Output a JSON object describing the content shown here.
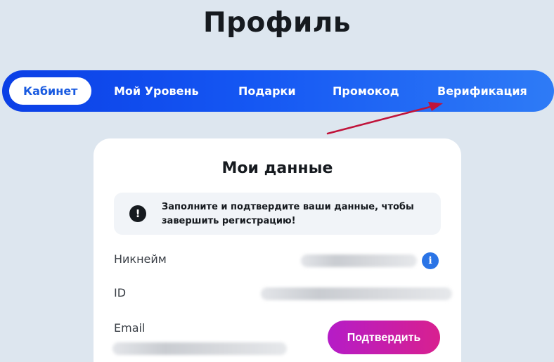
{
  "page": {
    "title": "Профиль"
  },
  "tabs": [
    {
      "label": "Кабинет",
      "active": true
    },
    {
      "label": "Мой Уровень",
      "active": false
    },
    {
      "label": "Подарки",
      "active": false
    },
    {
      "label": "Промокод",
      "active": false
    },
    {
      "label": "Верификация",
      "active": false
    }
  ],
  "card": {
    "title": "Мои данные",
    "notice": {
      "icon": "exclamation-icon",
      "text": "Заполните и подтвердите ваши данные, чтобы завершить регистрацию!"
    },
    "fields": [
      {
        "label": "Никнейм"
      },
      {
        "label": "ID"
      },
      {
        "label": "Email"
      }
    ],
    "info_icon": "i",
    "confirm_label": "Подтвердить"
  },
  "colors": {
    "tabs_gradient_start": "#0b3fe6",
    "tabs_gradient_end": "#2e7bf6",
    "active_tab_text": "#1a5be0",
    "confirm_gradient_start": "#b51cc7",
    "confirm_gradient_end": "#d8208f",
    "annotation_arrow": "#c0133a"
  }
}
